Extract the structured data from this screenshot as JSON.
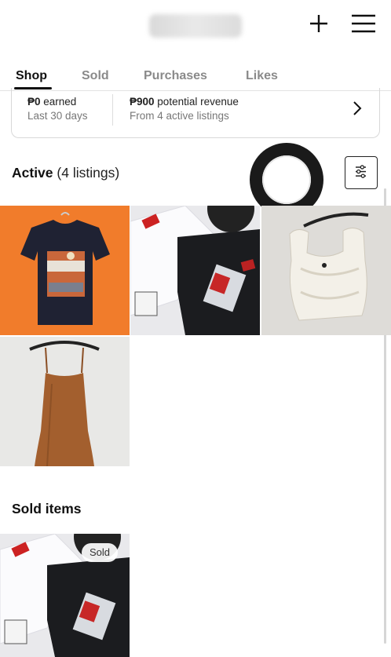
{
  "header": {
    "username": "jsillituan",
    "add_icon": "plus-icon",
    "menu_icon": "hamburger-menu-icon"
  },
  "tabs": [
    {
      "label": "Shop",
      "active": true
    },
    {
      "label": "Sold",
      "active": false
    },
    {
      "label": "Purchases",
      "active": false
    },
    {
      "label": "Likes",
      "active": false
    }
  ],
  "stats": {
    "earned_amount": "₱0",
    "earned_label": "earned",
    "earned_period": "Last 30 days",
    "revenue_amount": "₱900",
    "revenue_label": "potential revenue",
    "revenue_detail": "From 4 active listings"
  },
  "active_section": {
    "title": "Active",
    "count": "(4 listings)"
  },
  "active_listings": [
    {
      "item": "graphic black t-shirt",
      "background": "#f07a2a"
    },
    {
      "item": "white and black bagged shirts",
      "background": "#e7e7ea"
    },
    {
      "item": "white lace top on hanger",
      "background": "#e1e0dc"
    },
    {
      "item": "brown slip dress on hanger",
      "background": "#e6e6e4"
    }
  ],
  "sold_section": {
    "title": "Sold items",
    "badge": "Sold"
  },
  "colors": {
    "accent": "#111111",
    "muted": "#8a8a8a"
  }
}
